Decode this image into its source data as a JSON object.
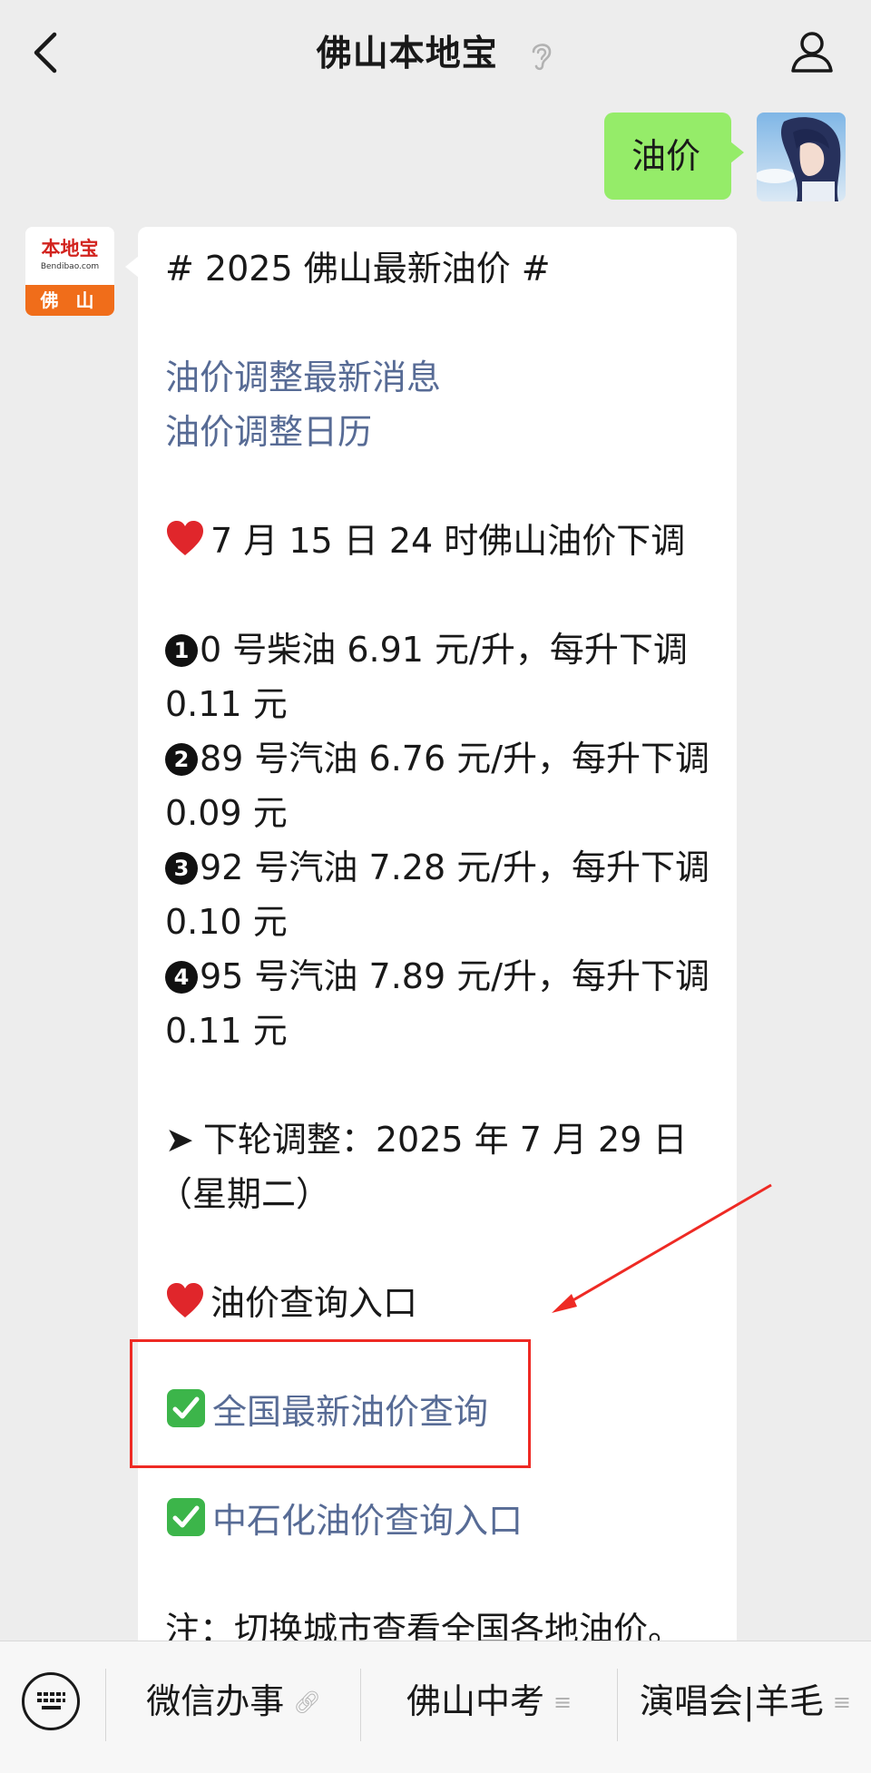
{
  "nav": {
    "title": "佛山本地宝"
  },
  "user_message": {
    "text": "油价"
  },
  "bot_avatar": {
    "logo_text": "本地宝",
    "logo_subtext": "Bendibao.com",
    "city": "佛 山"
  },
  "bot_message": {
    "hashtag": "# 2025 佛山最新油价 #",
    "link_latest_news": "油价调整最新消息",
    "link_calendar": "油价调整日历",
    "headline": "7 月 15 日 24 时佛山油价下调",
    "prices": [
      {
        "num": "1",
        "line1": "0 号柴油 6.91 元/升，每升下调",
        "line2": "0.11 元"
      },
      {
        "num": "2",
        "line1": "89 号汽油 6.76 元/升，每升下调",
        "line2": "0.09 元"
      },
      {
        "num": "3",
        "line1": "92 号汽油 7.28 元/升，每升下调",
        "line2": "0.10 元"
      },
      {
        "num": "4",
        "line1": "95 号汽油 7.89 元/升，每升下调",
        "line2": "0.11 元"
      }
    ],
    "next_adjust_line1": "下轮调整：2025 年 7 月 29 日",
    "next_adjust_line2": "（星期二）",
    "query_heading": "油价查询入口",
    "link_national": "全国最新油价查询",
    "link_sinopec": "中石化油价查询入口",
    "note": "注：切换城市查看全国各地油价。"
  },
  "bottom_menu": {
    "items": [
      {
        "label": "微信办事"
      },
      {
        "label": "佛山中考"
      },
      {
        "label": "演唱会|羊毛"
      }
    ]
  },
  "colors": {
    "link": "#576b95",
    "user_bubble": "#95ec69",
    "highlight": "#ee2a24"
  }
}
